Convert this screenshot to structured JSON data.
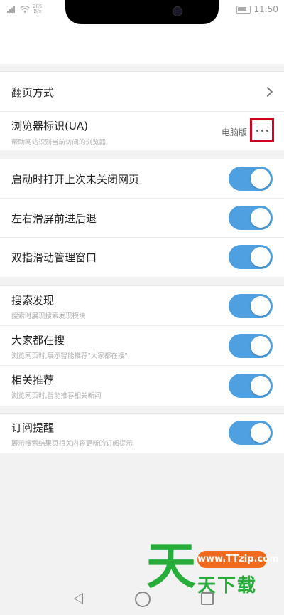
{
  "status_bar": {
    "speed_top": "285",
    "speed_bottom": "B/s",
    "time": "11:50"
  },
  "sections": {
    "page_ua": {
      "page_turn": {
        "title": "翻页方式"
      },
      "ua": {
        "title": "浏览器标识(UA)",
        "subtitle": "帮助网站识别当前访问的浏览器",
        "value": "电脑版"
      }
    },
    "toggles_a": [
      {
        "title": "启动时打开上次未关闭网页",
        "on": true
      },
      {
        "title": "左右滑屏前进后退",
        "on": true
      },
      {
        "title": "双指滑动管理窗口",
        "on": true
      }
    ],
    "toggles_b": [
      {
        "title": "搜索发现",
        "subtitle": "搜索时展现搜索发现模块",
        "on": true
      },
      {
        "title": "大家都在搜",
        "subtitle": "浏览网页时,展示智能推荐\"大家都在搜\"",
        "on": true
      },
      {
        "title": "相关推荐",
        "subtitle": "浏览网页时,智能推荐相关新闻",
        "on": true
      }
    ],
    "subscription": {
      "title": "订阅提醒",
      "subtitle": "展示搜索结果页相关内容更新的订阅提示",
      "on": true
    }
  },
  "watermark": {
    "glyph": "天",
    "url": "www.TTzip.com",
    "text": "天下载"
  },
  "colors": {
    "toggle_on": "#4ea0e0",
    "highlight": "#d0021b",
    "background": "#f2f2f2"
  },
  "icons": [
    "signal-icon",
    "wifi-icon",
    "battery-icon",
    "chevron-right-icon",
    "more-icon",
    "nav-back-icon",
    "nav-home-icon",
    "nav-recent-icon"
  ]
}
